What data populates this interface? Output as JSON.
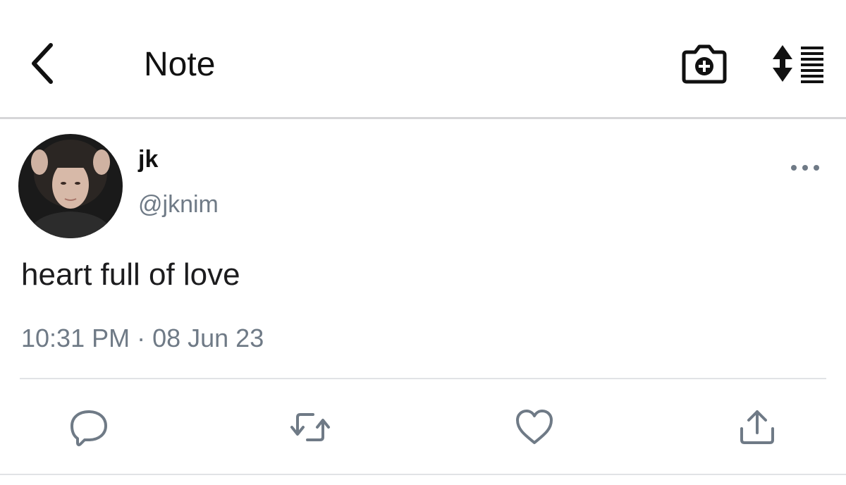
{
  "header": {
    "back_icon": "chevron-left-icon",
    "title": "Note",
    "camera_icon": "camera-add-icon",
    "sort_icon": "sort-list-icon"
  },
  "tweet": {
    "display_name": "jk",
    "handle": "@jknim",
    "text": "heart full of love",
    "timestamp": "10:31 PM · 08 Jun 23",
    "more_icon": "more-horizontal-icon"
  },
  "actions": [
    {
      "icon": "reply-icon"
    },
    {
      "icon": "retweet-icon"
    },
    {
      "icon": "like-heart-icon"
    },
    {
      "icon": "share-icon"
    }
  ],
  "colors": {
    "text_primary": "#111111",
    "text_secondary": "#6f7a86",
    "divider": "#d6d6d8",
    "icon": "#6f7a86"
  }
}
